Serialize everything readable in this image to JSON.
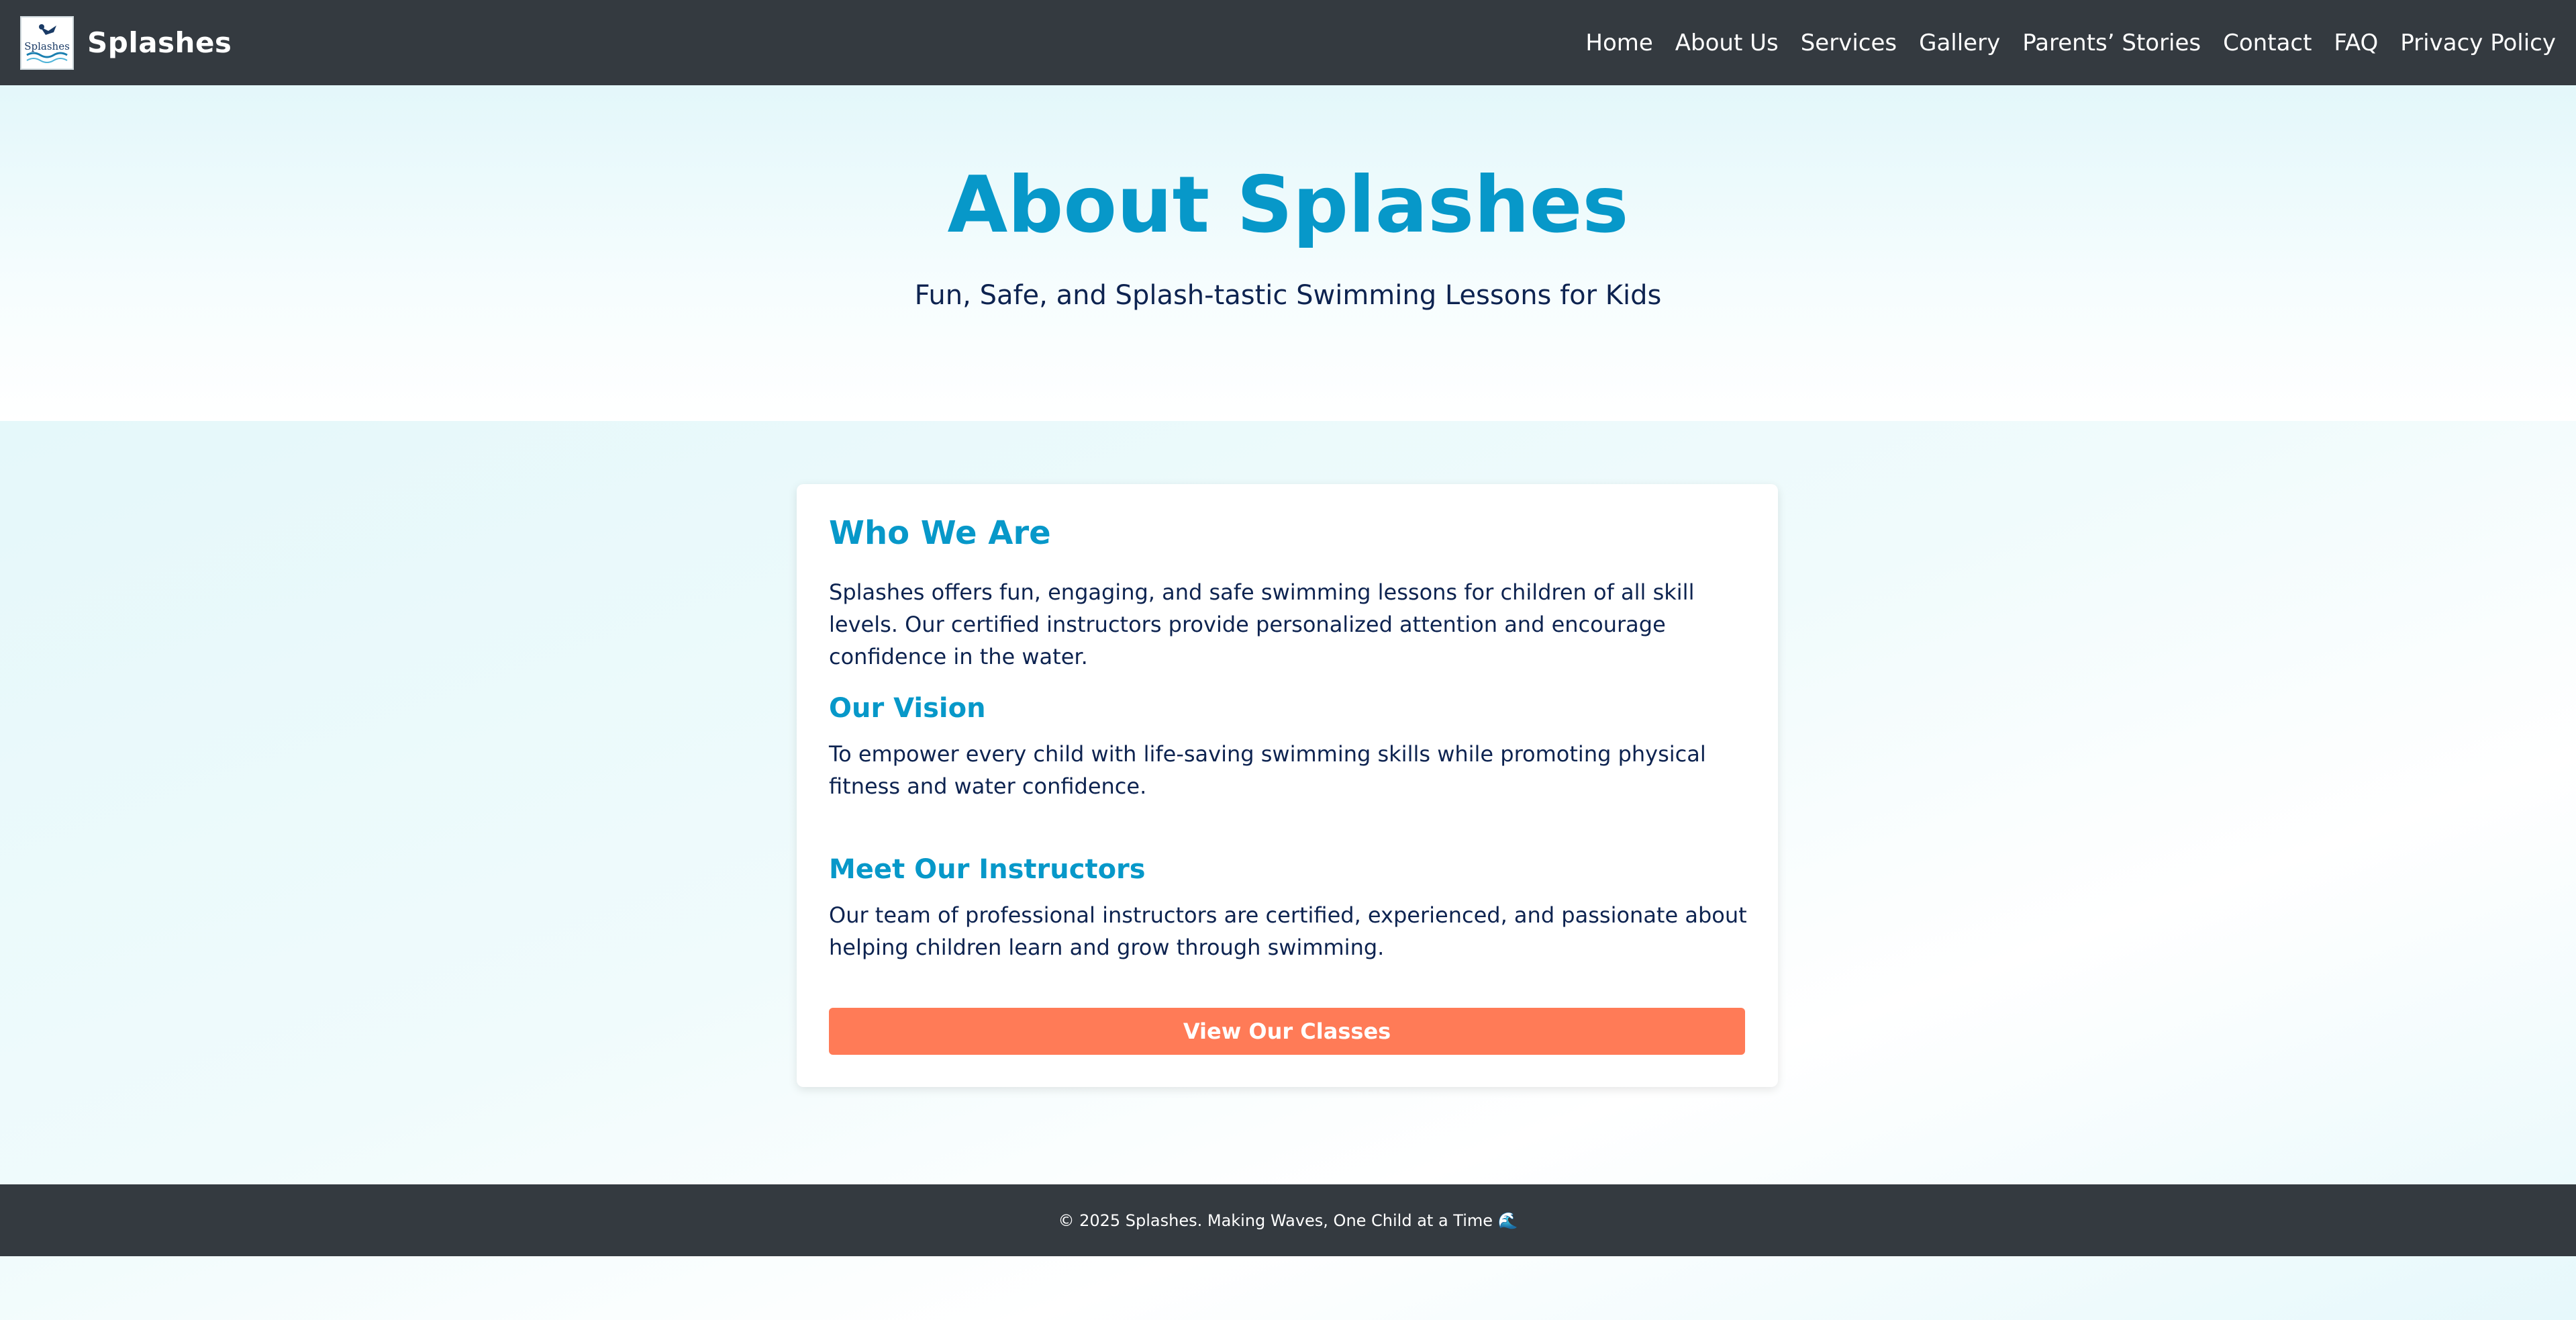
{
  "navbar": {
    "brand_name": "Splashes",
    "logo_text": "Splashes",
    "links": [
      "Home",
      "About Us",
      "Services",
      "Gallery",
      "Parents’ Stories",
      "Contact",
      "FAQ",
      "Privacy Policy"
    ]
  },
  "hero": {
    "title": "About Splashes",
    "subtitle": "Fun, Safe, and Splash-tastic Swimming Lessons for Kids"
  },
  "card": {
    "who_title": "Who We Are",
    "who_text": "Splashes offers fun, engaging, and safe swimming lessons for children of all skill levels. Our certified instructors provide personalized attention and encourage confidence in the water.",
    "vision_title": "Our Vision",
    "vision_text": "To empower every child with life-saving swimming skills while promoting physical fitness and water confidence.",
    "instructors_title": "Meet Our Instructors",
    "instructors_text": "Our team of professional instructors are certified, experienced, and passionate about helping children learn and grow through swimming.",
    "cta_label": "View Our Classes"
  },
  "footer": {
    "text": "© 2025 Splashes. Making Waves, One Child at a Time 🌊"
  },
  "colors": {
    "nav_bg": "#343a40",
    "accent": "#0798c9",
    "text_dark": "#0d2350",
    "cta": "#ff7b57"
  }
}
